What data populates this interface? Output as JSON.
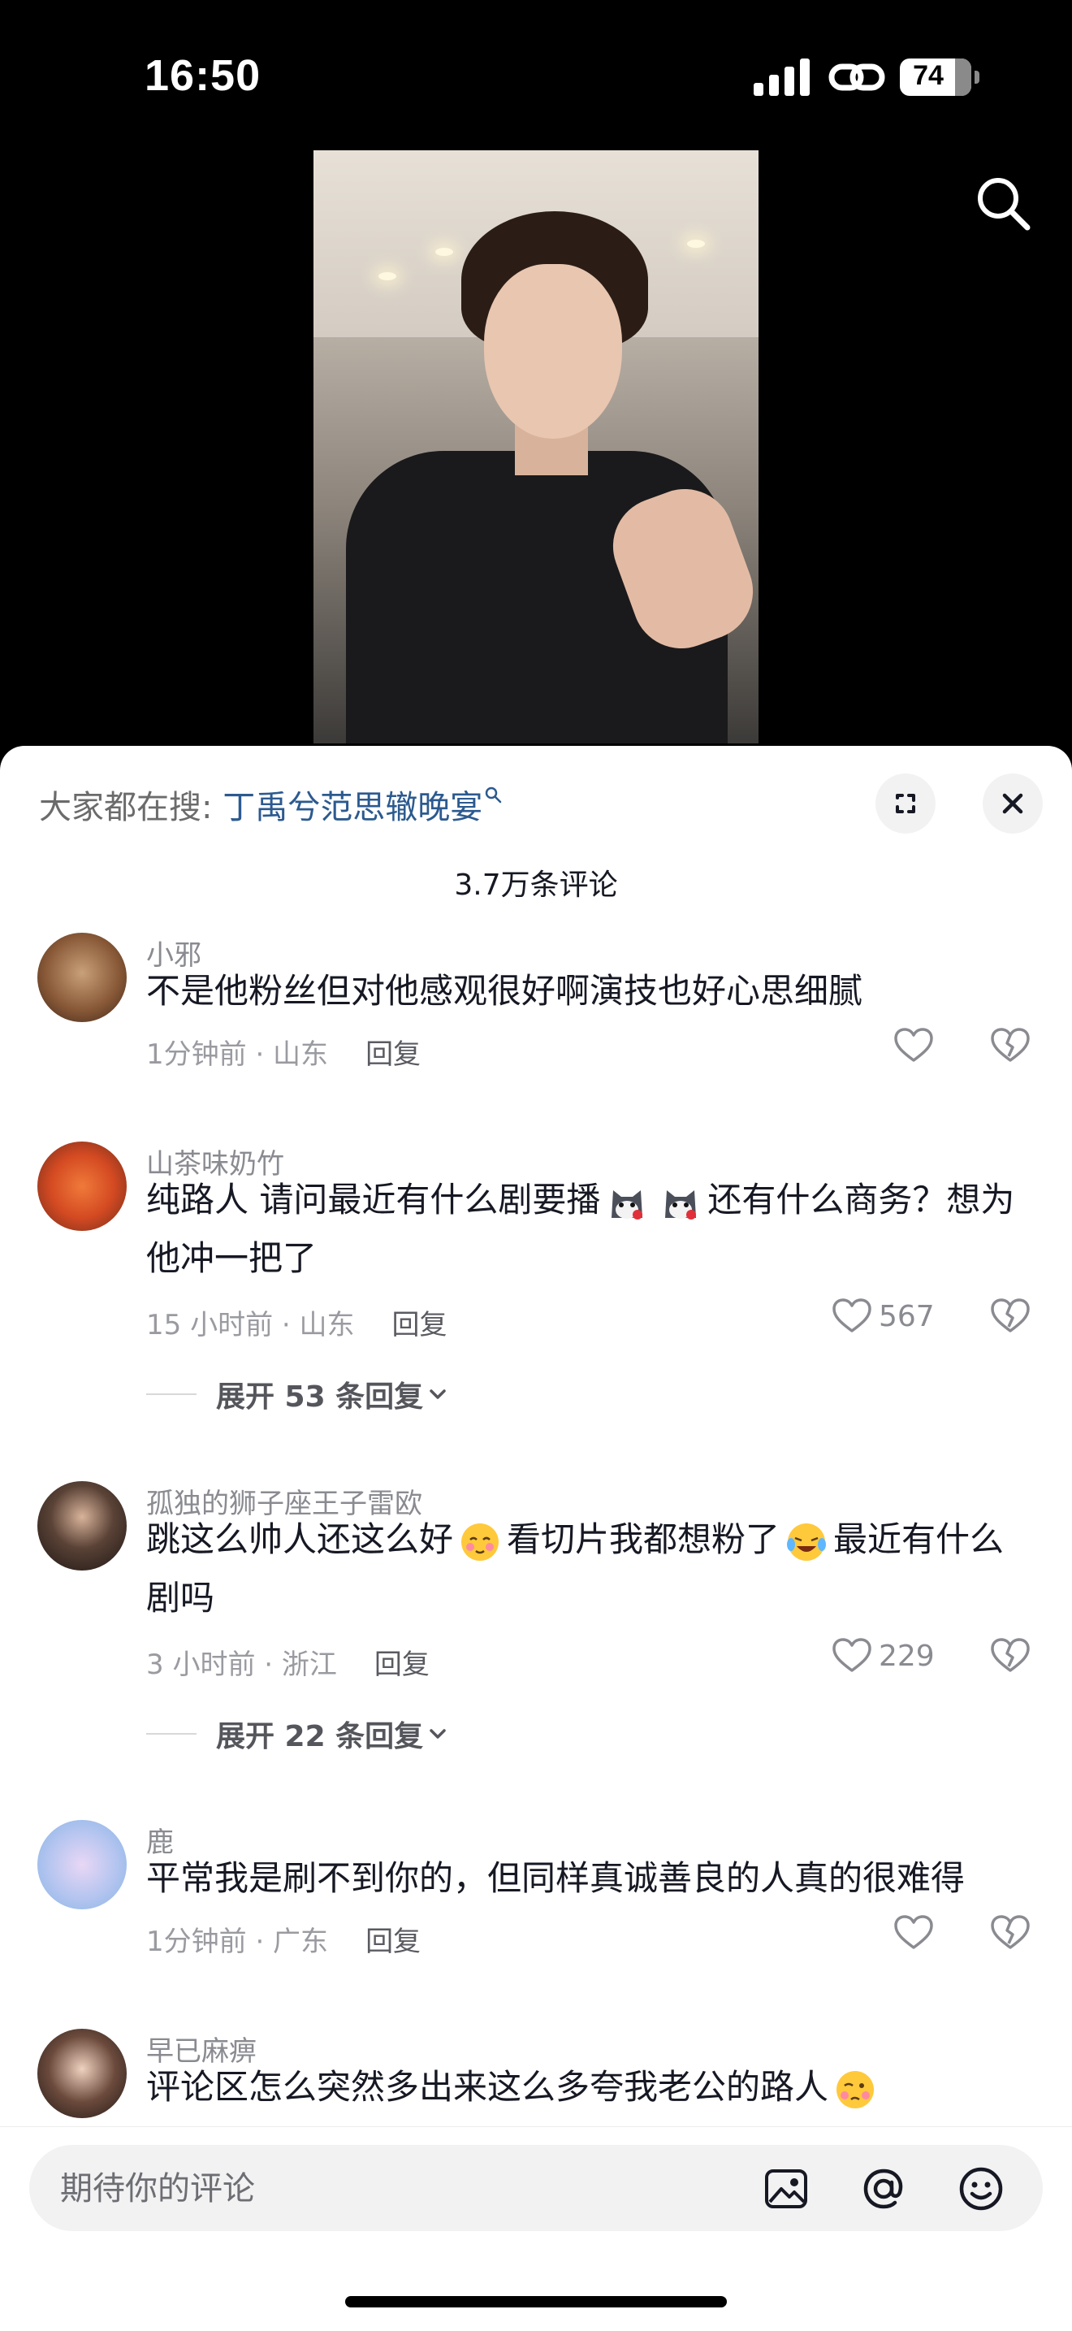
{
  "status_bar": {
    "time": "16:50",
    "battery": "74"
  },
  "hot_search": {
    "prefix": "大家都在搜: ",
    "keyword": "丁禹兮范思辙晚宴"
  },
  "comment_count": "3.7万条评论",
  "comments": [
    {
      "username": "小邪",
      "text": "不是他粉丝但对他感观很好啊演技也好心思细腻",
      "time_location": "1分钟前 · 山东",
      "reply_label": "回复",
      "likes": ""
    },
    {
      "username": "山茶味奶竹",
      "text_a": "纯路人 请问最近有什么剧要播",
      "text_b": "还有什么商务？想为他冲一把了",
      "time_location": "15 小时前 · 山东",
      "reply_label": "回复",
      "likes": "567",
      "expand_label": "展开 53 条回复"
    },
    {
      "username": "孤独的狮子座王子雷欧",
      "text_a": "跳这么帅人还这么好",
      "text_b": "看切片我都想粉了",
      "text_c": "最近有什么剧吗",
      "time_location": "3 小时前 · 浙江",
      "reply_label": "回复",
      "likes": "229",
      "expand_label": "展开 22 条回复"
    },
    {
      "username": "鹿",
      "text": "平常我是刷不到你的，但同样真诚善良的人真的很难得",
      "time_location": "1分钟前 · 广东",
      "reply_label": "回复",
      "likes": ""
    },
    {
      "username": "早已麻痹",
      "text": "评论区怎么突然多出来这么多夸我老公的路人"
    }
  ],
  "input": {
    "placeholder": "期待你的评论"
  },
  "icons": [
    "signal-icon",
    "link-icon",
    "battery-icon",
    "search-icon",
    "expand-icon",
    "close-icon",
    "heart-icon",
    "dislike-icon",
    "chevron-down-icon",
    "image-icon",
    "at-icon",
    "emoji-icon"
  ],
  "colors": {
    "keyword": "#2c5a8f",
    "meta": "#9a9ba1",
    "sheet": "#ffffff"
  }
}
